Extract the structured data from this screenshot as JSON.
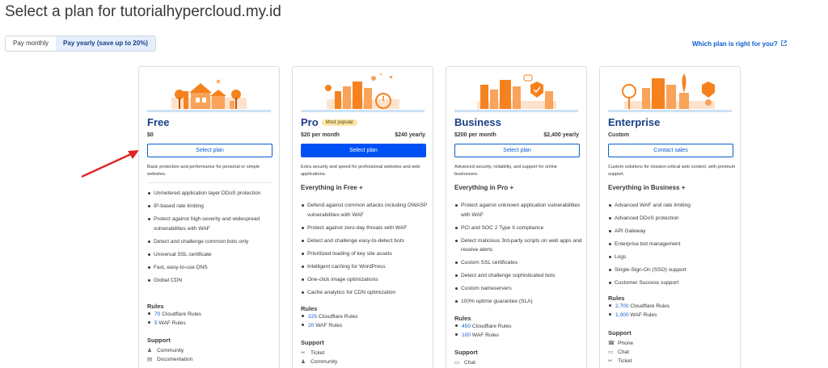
{
  "header": {
    "title": "Select a plan for tutorialhypercloud.my.id",
    "which_plan": "Which plan is right for you?"
  },
  "billing": {
    "monthly": "Pay monthly",
    "yearly": "Pay yearly (save up to 20%)",
    "selected": "yearly"
  },
  "plans": [
    {
      "name": "Free",
      "badge": "",
      "price": "$0",
      "yearly": "",
      "button": "Select plan",
      "desc": "Basic protection and performance for personal or simple websites.",
      "everything": "",
      "features": [
        "Unmetered application layer DDoS protection",
        "IP-based rate limiting",
        "Protect against high severity and widespread vulnerabilities with WAF",
        "Detect and challenge common bots only",
        "Universal SSL certificate",
        "Fast, easy-to-use DNS",
        "Global CDN"
      ],
      "rules_heading": "Rules",
      "rules": [
        {
          "num": "70",
          "label": "Cloudflare Rules"
        },
        {
          "num": "5",
          "label": "WAF Rules"
        }
      ],
      "support_heading": "Support",
      "support": [
        {
          "icon": "community-icon",
          "glyph": "♟",
          "label": "Community"
        },
        {
          "icon": "documentation-icon",
          "glyph": "▤",
          "label": "Documentation"
        }
      ]
    },
    {
      "name": "Pro",
      "badge": "Most popular",
      "price": "$20 per month",
      "yearly": "$240 yearly",
      "button": "Select plan",
      "desc": "Extra security and speed for professional websites and web applications.",
      "everything": "Everything in Free +",
      "features": [
        "Defend against common attacks including OWASP vulnerabilities with WAF",
        "Protect against zero-day threats with WAF",
        "Detect and challenge easy-to-detect bots",
        "Prioritized loading of key site assets",
        "Intelligent caching for WordPress",
        "One-click image optimizations",
        "Cache analytics for CDN optimization"
      ],
      "rules_heading": "Rules",
      "rules": [
        {
          "num": "225",
          "label": "Cloudflare Rules"
        },
        {
          "num": "20",
          "label": "WAF Rules"
        }
      ],
      "support_heading": "Support",
      "support": [
        {
          "icon": "ticket-icon",
          "glyph": "✂",
          "label": "Ticket"
        },
        {
          "icon": "community-icon",
          "glyph": "♟",
          "label": "Community"
        }
      ]
    },
    {
      "name": "Business",
      "badge": "",
      "price": "$200 per month",
      "yearly": "$2,400 yearly",
      "button": "Select plan",
      "desc": "Advanced security, reliability, and support for online businesses.",
      "everything": "Everything in Pro +",
      "features": [
        "Protect against unknown application vulnerabilities with WAF",
        "PCI and SOC 2 Type II compliance",
        "Detect malicious 3rd-party scripts on web apps and receive alerts",
        "Custom SSL certificates",
        "Detect and challenge sophisticated bots",
        "Custom nameservers",
        "100% uptime guarantee (SLA)"
      ],
      "rules_heading": "Rules",
      "rules": [
        {
          "num": "450",
          "label": "Cloudflare Rules"
        },
        {
          "num": "100",
          "label": "WAF Rules"
        }
      ],
      "support_heading": "Support",
      "support": [
        {
          "icon": "chat-icon",
          "glyph": "▭",
          "label": "Chat"
        }
      ]
    },
    {
      "name": "Enterprise",
      "badge": "",
      "price": "Custom",
      "yearly": "",
      "button": "Contact sales",
      "desc": "Custom solutions for mission-critical web content, with premium support.",
      "everything": "Everything in Business +",
      "features": [
        "Advanced WAF and rate limiting",
        "Advanced DDoS protection",
        "API Gateway",
        "Enterprise bot management",
        "Logs",
        "Single-Sign-On (SSO) support",
        "Customer Success support"
      ],
      "rules_heading": "Rules",
      "rules": [
        {
          "num": "2,700",
          "label": "Cloudflare Rules"
        },
        {
          "num": "1,000",
          "label": "WAF Rules"
        }
      ],
      "support_heading": "Support",
      "support": [
        {
          "icon": "phone-icon",
          "glyph": "☎",
          "label": "Phone"
        },
        {
          "icon": "chat-icon",
          "glyph": "▭",
          "label": "Chat"
        },
        {
          "icon": "ticket-icon",
          "glyph": "✂",
          "label": "Ticket"
        }
      ]
    }
  ],
  "colors": {
    "accent": "#0051f5",
    "link": "#0a5ecf",
    "plan_name": "#1a3f86",
    "badge_bg": "#fce6a8",
    "arrow": "#e02424",
    "illustration_orange": "#f6821f"
  }
}
